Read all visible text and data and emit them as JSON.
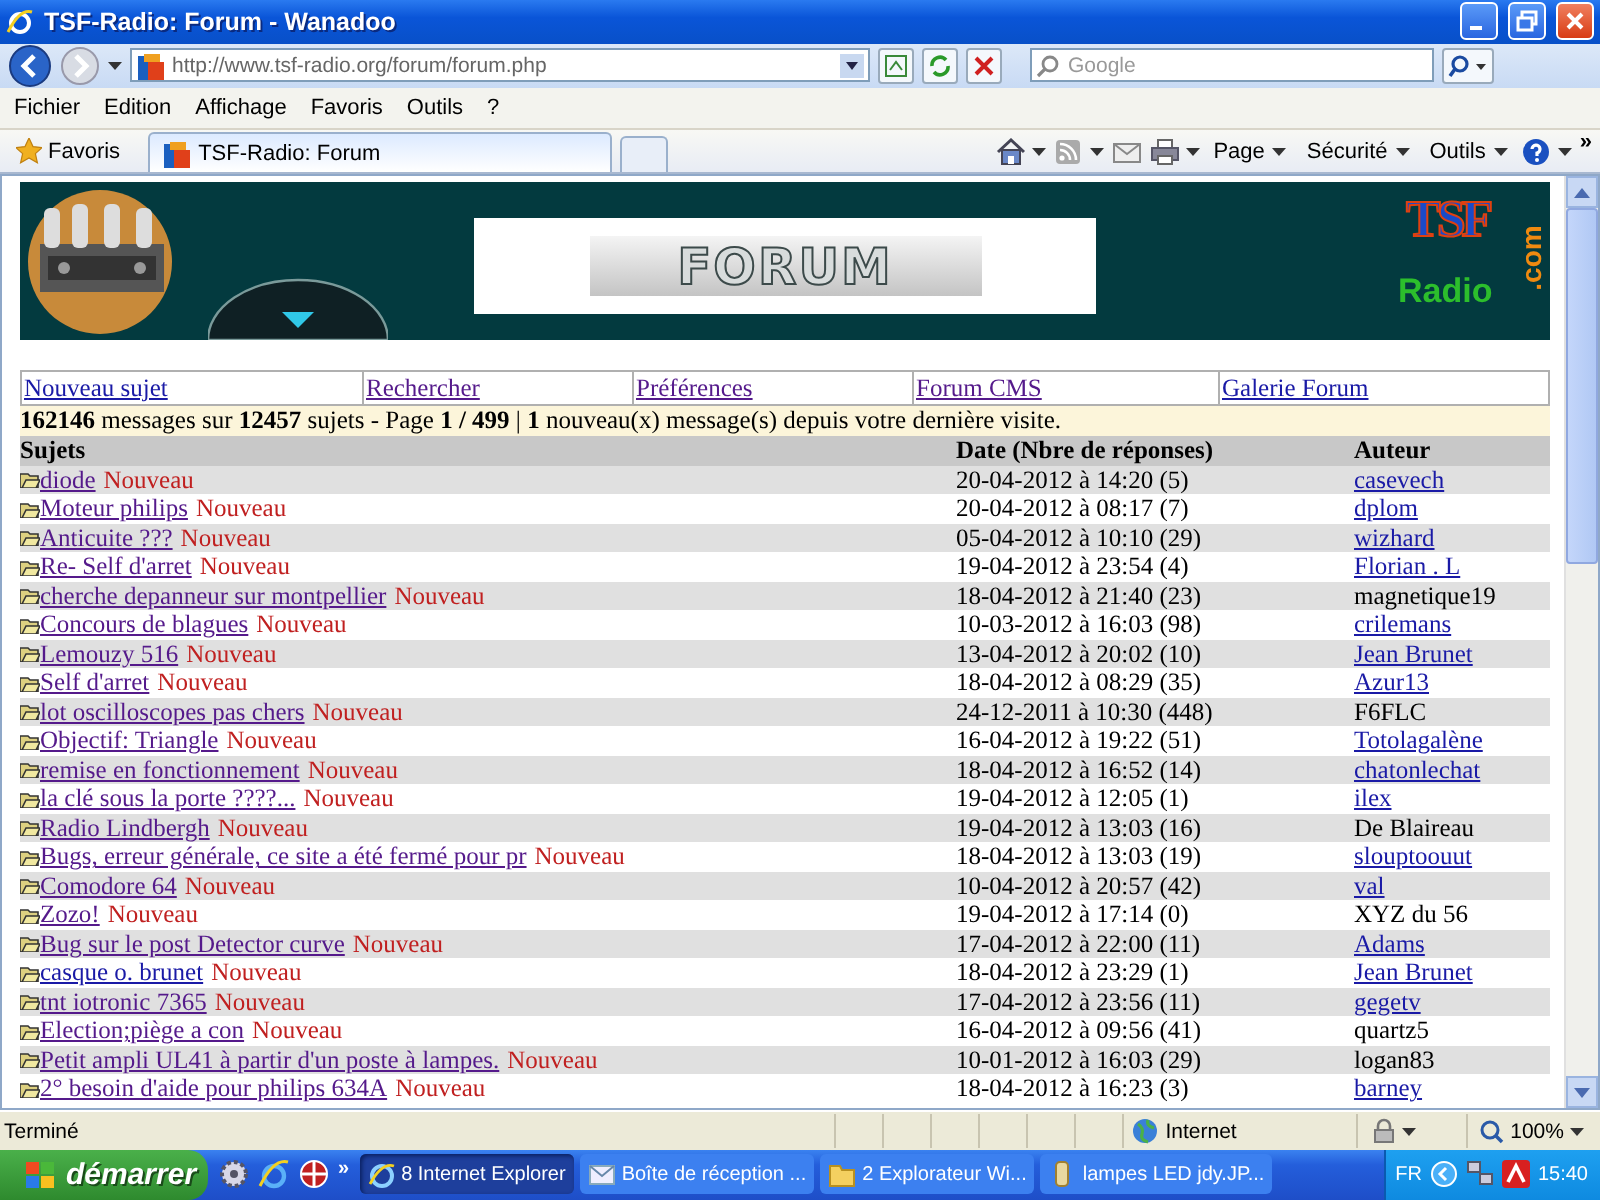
{
  "window": {
    "title": "TSF-Radio: Forum - Wanadoo"
  },
  "address_bar": {
    "url": "http://www.tsf-radio.org/forum/forum.php"
  },
  "search": {
    "placeholder": "Google"
  },
  "menu": [
    "Fichier",
    "Edition",
    "Affichage",
    "Favoris",
    "Outils",
    "?"
  ],
  "favorites_bar": {
    "label": "Favoris",
    "tabs": [
      {
        "label": "TSF-Radio: Forum",
        "selected": true
      }
    ]
  },
  "command_bar": {
    "menus": [
      "Page",
      "Sécurité",
      "Outils"
    ],
    "more": "»"
  },
  "banner": {
    "title": "FORUM",
    "logo_letters": "TSF",
    "logo_word": "Radio",
    "logo_suffix": ".com"
  },
  "nav": [
    {
      "label": "Nouveau sujet",
      "visited": false
    },
    {
      "label": "Rechercher",
      "visited": true
    },
    {
      "label": "Préférences",
      "visited": true
    },
    {
      "label": "Forum CMS",
      "visited": true
    },
    {
      "label": "Galerie Forum",
      "visited": false
    }
  ],
  "summary": "**162146** messages sur **12457** sujets - Page **1 / 499** | **1** nouveau(x) message(s) depuis votre dernière visite.",
  "table": {
    "columns": [
      "Sujets",
      "Date (Nbre de réponses)",
      "Auteur"
    ],
    "rows": [
      {
        "subject": "diode",
        "visited": true,
        "badge": "Nouveau",
        "date": "20-04-2012 à 14:20 (5)",
        "author": "casevech",
        "author_link": true
      },
      {
        "subject": "Moteur philips",
        "visited": true,
        "badge": "Nouveau",
        "date": "20-04-2012 à 08:17 (7)",
        "author": "dplom",
        "author_link": true
      },
      {
        "subject": "Anticuite ???",
        "visited": true,
        "badge": "Nouveau",
        "date": "05-04-2012 à 10:10 (29)",
        "author": "wizhard",
        "author_link": true
      },
      {
        "subject": "Re- Self d'arret",
        "visited": true,
        "badge": "Nouveau",
        "date": "19-04-2012 à 23:54 (4)",
        "author": "Florian . L",
        "author_link": true
      },
      {
        "subject": "cherche depanneur sur montpellier",
        "visited": true,
        "badge": "Nouveau",
        "date": "18-04-2012 à 21:40 (23)",
        "author": "magnetique19",
        "author_link": false
      },
      {
        "subject": "Concours de blagues",
        "visited": true,
        "badge": "Nouveau",
        "date": "10-03-2012 à 16:03 (98)",
        "author": "crilemans",
        "author_link": true
      },
      {
        "subject": "Lemouzy 516",
        "visited": true,
        "badge": "Nouveau",
        "date": "13-04-2012 à 20:02 (10)",
        "author": "Jean Brunet",
        "author_link": true
      },
      {
        "subject": "Self d'arret",
        "visited": true,
        "badge": "Nouveau",
        "date": "18-04-2012 à 08:29 (35)",
        "author": "Azur13",
        "author_link": true
      },
      {
        "subject": "lot oscilloscopes pas chers",
        "visited": true,
        "badge": "Nouveau",
        "date": "24-12-2011 à 10:30 (448)",
        "author": "F6FLC",
        "author_link": false
      },
      {
        "subject": "Objectif: Triangle",
        "visited": true,
        "badge": "Nouveau",
        "date": "16-04-2012 à 19:22 (51)",
        "author": "Totolagalène",
        "author_link": true
      },
      {
        "subject": "remise en fonctionnement",
        "visited": true,
        "badge": "Nouveau",
        "date": "18-04-2012 à 16:52 (14)",
        "author": "chatonlechat",
        "author_link": true
      },
      {
        "subject": "la clé sous la porte ????...",
        "visited": true,
        "badge": "Nouveau",
        "date": "19-04-2012 à 12:05 (1)",
        "author": "ilex",
        "author_link": true
      },
      {
        "subject": "Radio Lindbergh",
        "visited": true,
        "badge": "Nouveau",
        "date": "19-04-2012 à 13:03 (16)",
        "author": "De Blaireau",
        "author_link": false
      },
      {
        "subject": "Bugs, erreur générale, ce site a été fermé pour pr",
        "visited": true,
        "badge": "Nouveau",
        "date": "18-04-2012 à 13:03 (19)",
        "author": "slouptoouut",
        "author_link": true
      },
      {
        "subject": "Comodore 64",
        "visited": true,
        "badge": "Nouveau",
        "date": "10-04-2012 à 20:57 (42)",
        "author": "val",
        "author_link": true
      },
      {
        "subject": "Zozo!",
        "visited": true,
        "badge": "Nouveau",
        "date": "19-04-2012 à 17:14 (0)",
        "author": "XYZ du 56",
        "author_link": false
      },
      {
        "subject": "Bug sur le post Detector curve",
        "visited": true,
        "badge": "Nouveau",
        "date": "17-04-2012 à 22:00 (11)",
        "author": "Adams",
        "author_link": true
      },
      {
        "subject": "casque o. brunet",
        "visited": false,
        "badge": "Nouveau",
        "date": "18-04-2012 à 23:29 (1)",
        "author": "Jean Brunet",
        "author_link": true
      },
      {
        "subject": "tnt iotronic 7365",
        "visited": true,
        "badge": "Nouveau",
        "date": "17-04-2012 à 23:56 (11)",
        "author": "gegetv",
        "author_link": true
      },
      {
        "subject": "Election;piège a con",
        "visited": true,
        "badge": "Nouveau",
        "date": "16-04-2012 à 09:56 (41)",
        "author": "quartz5",
        "author_link": false
      },
      {
        "subject": "Petit ampli UL41 à partir d'un poste à lampes.",
        "visited": true,
        "badge": "Nouveau",
        "date": "10-01-2012 à 16:03 (29)",
        "author": "logan83",
        "author_link": false
      },
      {
        "subject": "2° besoin d'aide pour philips 634A",
        "visited": true,
        "badge": "Nouveau",
        "date": "18-04-2012 à 16:23 (3)",
        "author": "barney",
        "author_link": true
      }
    ]
  },
  "status_bar": {
    "text": "Terminé",
    "zone": "Internet",
    "zoom": "100%"
  },
  "taskbar": {
    "start": "démarrer",
    "quick_launch_more": "»",
    "tasks": [
      {
        "label": "8 Internet Explorer",
        "selected": true
      },
      {
        "label": "Boîte de réception ...",
        "selected": false
      },
      {
        "label": "2 Explorateur Wi...",
        "selected": false
      },
      {
        "label": "lampes LED jdy.JP...",
        "selected": false
      }
    ],
    "language": "FR",
    "clock": "15:40"
  }
}
